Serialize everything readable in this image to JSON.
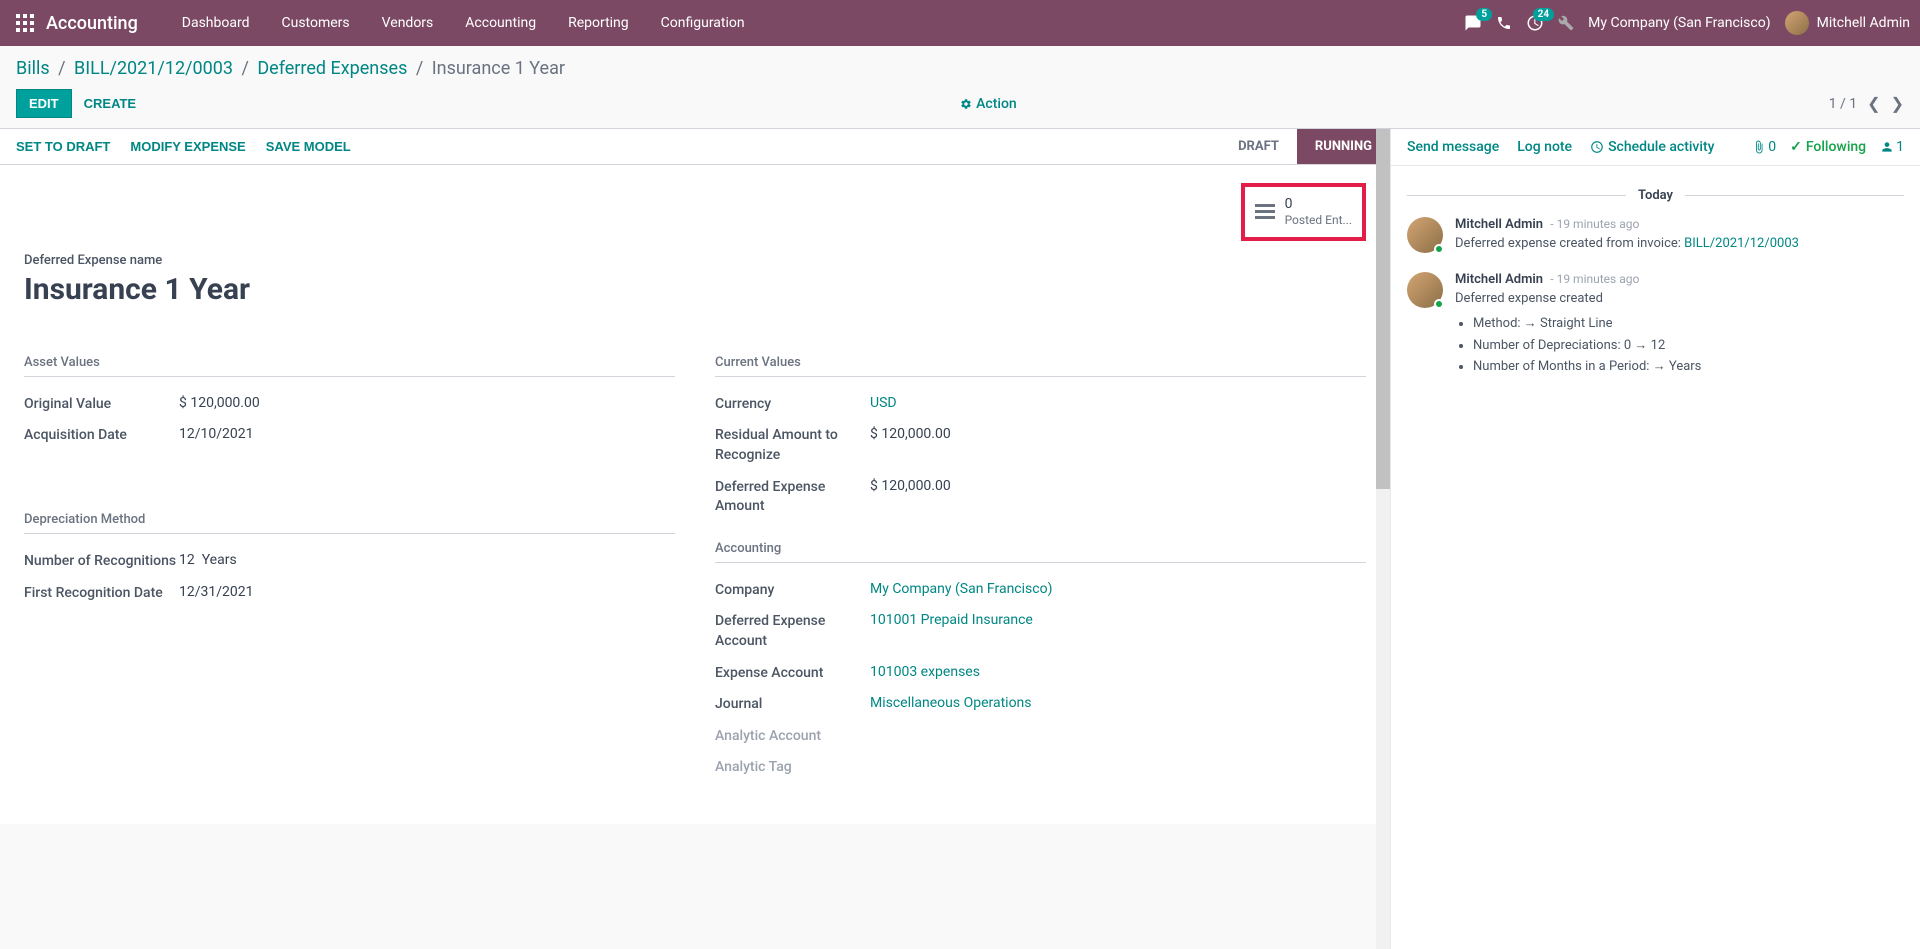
{
  "topnav": {
    "brand": "Accounting",
    "menu": [
      "Dashboard",
      "Customers",
      "Vendors",
      "Accounting",
      "Reporting",
      "Configuration"
    ],
    "chat_badge": "5",
    "activity_badge": "24",
    "company": "My Company (San Francisco)",
    "user": "Mitchell Admin"
  },
  "breadcrumb": {
    "items": [
      "Bills",
      "BILL/2021/12/0003",
      "Deferred Expenses"
    ],
    "current": "Insurance 1 Year"
  },
  "controlbar": {
    "edit": "EDIT",
    "create": "CREATE",
    "action": "Action",
    "pager": "1 / 1"
  },
  "statusbar": {
    "buttons": [
      "SET TO DRAFT",
      "MODIFY EXPENSE",
      "SAVE MODEL"
    ],
    "statuses": [
      {
        "label": "DRAFT",
        "active": false
      },
      {
        "label": "RUNNING",
        "active": true
      }
    ]
  },
  "smart_button": {
    "count": "0",
    "label": "Posted Ent..."
  },
  "record": {
    "name_label": "Deferred Expense name",
    "name": "Insurance 1 Year"
  },
  "asset_values": {
    "title": "Asset Values",
    "original_value_label": "Original Value",
    "original_value": "$ 120,000.00",
    "acquisition_date_label": "Acquisition Date",
    "acquisition_date": "12/10/2021"
  },
  "current_values": {
    "title": "Current Values",
    "currency_label": "Currency",
    "currency": "USD",
    "residual_label": "Residual Amount to Recognize",
    "residual": "$ 120,000.00",
    "deferred_amount_label": "Deferred Expense Amount",
    "deferred_amount": "$ 120,000.00"
  },
  "depreciation": {
    "title": "Depreciation Method",
    "recognitions_label": "Number of Recognitions",
    "recognitions_num": "12",
    "recognitions_unit": "Years",
    "first_date_label": "First Recognition Date",
    "first_date": "12/31/2021"
  },
  "accounting": {
    "title": "Accounting",
    "company_label": "Company",
    "company": "My Company (San Francisco)",
    "deferred_account_label": "Deferred Expense Account",
    "deferred_account": "101001 Prepaid Insurance",
    "expense_account_label": "Expense Account",
    "expense_account": "101003 expenses",
    "journal_label": "Journal",
    "journal": "Miscellaneous Operations",
    "analytic_account_label": "Analytic Account",
    "analytic_tag_label": "Analytic Tag"
  },
  "chatter": {
    "send": "Send message",
    "log": "Log note",
    "schedule": "Schedule activity",
    "attach_count": "0",
    "following": "Following",
    "followers_count": "1",
    "today": "Today",
    "messages": [
      {
        "author": "Mitchell Admin",
        "time": "- 19 minutes ago",
        "text": "Deferred expense created from invoice: ",
        "link": "BILL/2021/12/0003"
      },
      {
        "author": "Mitchell Admin",
        "time": "- 19 minutes ago",
        "text": "Deferred expense created",
        "bullets": [
          {
            "label": "Method:",
            "arrow": "→",
            "value": "Straight Line"
          },
          {
            "label": "Number of Depreciations: 0",
            "arrow": "→",
            "value": "12"
          },
          {
            "label": "Number of Months in a Period:",
            "arrow": "→",
            "value": "Years"
          }
        ]
      }
    ]
  }
}
